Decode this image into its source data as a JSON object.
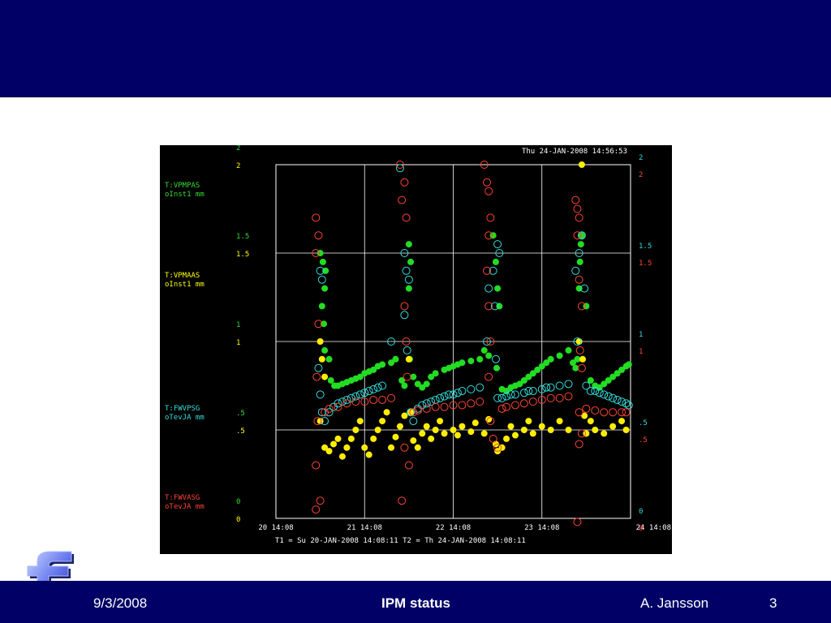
{
  "slide": {
    "footer_date": "9/3/2008",
    "footer_title": "IPM status",
    "footer_author": "A. Jansson",
    "footer_page": "3",
    "logo_letter": "f",
    "colors": {
      "bar": "#000066",
      "background": "#ffffff",
      "plot_bg": "#000000"
    }
  },
  "chart_data": {
    "type": "scatter",
    "title": "Thu 24-JAN-2008 14:56:53",
    "timespan": "T1 = Su 20-JAN-2008 14:08:11       T2 = Th 24-JAN-2008 14:08:11",
    "x_ticks": [
      "20 14:08",
      "21 14:08",
      "22 14:08",
      "23 14:08",
      "24 14:08"
    ],
    "xlim": [
      0,
      4
    ],
    "x_unit": "days after 20-JAN-2008 14:08",
    "ylim": [
      0,
      2
    ],
    "grid": true,
    "left_axes": [
      {
        "color": "#33dd33",
        "name": "T:VPMPAS",
        "desc": "oInst1  mm",
        "ticks": [
          "2",
          "1.5",
          "1",
          ".5",
          "0"
        ]
      },
      {
        "color": "#ffff00",
        "name": "T:VPMAAS",
        "desc": "oInst1  mm",
        "ticks": [
          "2",
          "1.5",
          "1",
          ".5",
          "0"
        ]
      }
    ],
    "right_axes": [
      {
        "color": "#33dddd",
        "name": "T:FWVPSG",
        "desc": "oTevJA  mm",
        "ticks": [
          "2",
          "1.5",
          "1",
          ".5",
          "0"
        ]
      },
      {
        "color": "#ff4433",
        "name": "T:FWVASG",
        "desc": "oTevJA  mm",
        "ticks": [
          "2",
          "1.5",
          "1",
          ".5",
          "0"
        ]
      }
    ],
    "series": [
      {
        "name": "T:VPMPAS",
        "color": "#22dd22",
        "marker": "filled",
        "points": [
          [
            0.55,
            1.3
          ],
          [
            0.5,
            1.5
          ],
          [
            0.53,
            1.45
          ],
          [
            0.56,
            1.4
          ],
          [
            0.52,
            1.2
          ],
          [
            0.54,
            1.1
          ],
          [
            0.55,
            0.95
          ],
          [
            0.6,
            0.9
          ],
          [
            0.62,
            0.78
          ],
          [
            0.66,
            0.75
          ],
          [
            0.7,
            0.75
          ],
          [
            0.75,
            0.76
          ],
          [
            0.8,
            0.77
          ],
          [
            0.85,
            0.78
          ],
          [
            0.9,
            0.79
          ],
          [
            0.95,
            0.8
          ],
          [
            1.0,
            0.82
          ],
          [
            1.05,
            0.83
          ],
          [
            1.1,
            0.84
          ],
          [
            1.15,
            0.86
          ],
          [
            1.2,
            0.87
          ],
          [
            1.3,
            0.88
          ],
          [
            1.35,
            0.9
          ],
          [
            1.42,
            0.78
          ],
          [
            1.45,
            0.75
          ],
          [
            1.5,
            1.55
          ],
          [
            1.52,
            1.45
          ],
          [
            1.5,
            1.3
          ],
          [
            1.51,
            0.9
          ],
          [
            1.55,
            0.8
          ],
          [
            1.6,
            0.76
          ],
          [
            1.65,
            0.74
          ],
          [
            1.7,
            0.76
          ],
          [
            1.75,
            0.8
          ],
          [
            1.8,
            0.82
          ],
          [
            1.9,
            0.84
          ],
          [
            1.95,
            0.85
          ],
          [
            2.0,
            0.86
          ],
          [
            2.05,
            0.87
          ],
          [
            2.1,
            0.88
          ],
          [
            2.2,
            0.89
          ],
          [
            2.3,
            0.9
          ],
          [
            2.35,
            0.95
          ],
          [
            2.4,
            0.92
          ],
          [
            2.45,
            1.6
          ],
          [
            2.48,
            1.45
          ],
          [
            2.5,
            1.3
          ],
          [
            2.52,
            1.2
          ],
          [
            2.49,
            0.85
          ],
          [
            2.55,
            0.73
          ],
          [
            2.6,
            0.72
          ],
          [
            2.65,
            0.74
          ],
          [
            2.7,
            0.75
          ],
          [
            2.75,
            0.76
          ],
          [
            2.8,
            0.78
          ],
          [
            2.85,
            0.8
          ],
          [
            2.9,
            0.82
          ],
          [
            2.95,
            0.84
          ],
          [
            3.0,
            0.86
          ],
          [
            3.05,
            0.88
          ],
          [
            3.1,
            0.9
          ],
          [
            3.2,
            0.92
          ],
          [
            3.3,
            0.95
          ],
          [
            3.35,
            0.88
          ],
          [
            3.38,
            0.85
          ],
          [
            3.4,
            0.9
          ],
          [
            3.42,
            1.3
          ],
          [
            3.43,
            1.45
          ],
          [
            3.44,
            1.55
          ],
          [
            3.45,
            1.6
          ],
          [
            3.5,
            1.2
          ],
          [
            3.55,
            0.78
          ],
          [
            3.6,
            0.75
          ],
          [
            3.65,
            0.74
          ],
          [
            3.7,
            0.76
          ],
          [
            3.75,
            0.78
          ],
          [
            3.8,
            0.8
          ],
          [
            3.85,
            0.82
          ],
          [
            3.9,
            0.84
          ],
          [
            3.95,
            0.86
          ],
          [
            3.98,
            0.87
          ]
        ]
      },
      {
        "name": "T:VPMAAS",
        "color": "#ffee00",
        "marker": "filled",
        "points": [
          [
            0.5,
            1.0
          ],
          [
            0.52,
            0.9
          ],
          [
            0.55,
            0.8
          ],
          [
            0.5,
            0.55
          ],
          [
            0.55,
            0.4
          ],
          [
            0.6,
            0.38
          ],
          [
            0.65,
            0.42
          ],
          [
            0.7,
            0.45
          ],
          [
            0.75,
            0.35
          ],
          [
            0.8,
            0.4
          ],
          [
            0.85,
            0.45
          ],
          [
            0.9,
            0.5
          ],
          [
            0.95,
            0.55
          ],
          [
            1.0,
            0.4
          ],
          [
            1.05,
            0.36
          ],
          [
            1.1,
            0.45
          ],
          [
            1.15,
            0.5
          ],
          [
            1.2,
            0.55
          ],
          [
            1.25,
            0.6
          ],
          [
            1.3,
            0.4
          ],
          [
            1.35,
            0.46
          ],
          [
            1.4,
            0.52
          ],
          [
            1.45,
            0.58
          ],
          [
            1.5,
            0.9
          ],
          [
            1.52,
            0.6
          ],
          [
            1.55,
            0.44
          ],
          [
            1.6,
            0.4
          ],
          [
            1.65,
            0.48
          ],
          [
            1.7,
            0.52
          ],
          [
            1.75,
            0.45
          ],
          [
            1.8,
            0.5
          ],
          [
            1.85,
            0.55
          ],
          [
            1.9,
            0.48
          ],
          [
            2.0,
            0.5
          ],
          [
            2.05,
            0.47
          ],
          [
            2.1,
            0.52
          ],
          [
            2.2,
            0.49
          ],
          [
            2.25,
            0.54
          ],
          [
            2.35,
            0.48
          ],
          [
            2.4,
            0.56
          ],
          [
            2.48,
            0.42
          ],
          [
            2.5,
            0.38
          ],
          [
            2.55,
            0.4
          ],
          [
            2.6,
            0.45
          ],
          [
            2.65,
            0.52
          ],
          [
            2.7,
            0.47
          ],
          [
            2.8,
            0.5
          ],
          [
            2.85,
            0.55
          ],
          [
            2.9,
            0.48
          ],
          [
            3.0,
            0.52
          ],
          [
            3.1,
            0.5
          ],
          [
            3.2,
            0.55
          ],
          [
            3.3,
            0.5
          ],
          [
            3.42,
            1.0
          ],
          [
            3.45,
            2.0
          ],
          [
            3.46,
            0.9
          ],
          [
            3.48,
            0.58
          ],
          [
            3.5,
            0.48
          ],
          [
            3.55,
            0.55
          ],
          [
            3.6,
            0.5
          ],
          [
            3.7,
            0.48
          ],
          [
            3.8,
            0.52
          ],
          [
            3.9,
            0.55
          ],
          [
            3.95,
            0.5
          ]
        ]
      },
      {
        "name": "T:FWVPSG",
        "color": "#33dddd",
        "marker": "hollow",
        "points": [
          [
            0.5,
            1.4
          ],
          [
            0.52,
            1.35
          ],
          [
            0.48,
            0.85
          ],
          [
            0.5,
            0.7
          ],
          [
            0.52,
            0.6
          ],
          [
            0.55,
            0.55
          ],
          [
            0.6,
            0.6
          ],
          [
            0.65,
            0.63
          ],
          [
            0.7,
            0.65
          ],
          [
            0.75,
            0.66
          ],
          [
            0.8,
            0.67
          ],
          [
            0.85,
            0.68
          ],
          [
            0.9,
            0.69
          ],
          [
            0.95,
            0.7
          ],
          [
            1.0,
            0.71
          ],
          [
            1.05,
            0.72
          ],
          [
            1.1,
            0.73
          ],
          [
            1.15,
            0.74
          ],
          [
            1.2,
            0.75
          ],
          [
            1.3,
            1.0
          ],
          [
            1.4,
            1.98
          ],
          [
            1.45,
            1.5
          ],
          [
            1.47,
            1.4
          ],
          [
            1.5,
            1.35
          ],
          [
            1.45,
            1.15
          ],
          [
            1.48,
            0.95
          ],
          [
            1.52,
            0.6
          ],
          [
            1.55,
            0.55
          ],
          [
            1.6,
            0.62
          ],
          [
            1.65,
            0.64
          ],
          [
            1.7,
            0.65
          ],
          [
            1.75,
            0.66
          ],
          [
            1.8,
            0.67
          ],
          [
            1.85,
            0.68
          ],
          [
            1.9,
            0.69
          ],
          [
            1.95,
            0.7
          ],
          [
            2.0,
            0.7
          ],
          [
            2.05,
            0.71
          ],
          [
            2.1,
            0.72
          ],
          [
            2.2,
            0.73
          ],
          [
            2.3,
            0.74
          ],
          [
            2.38,
            1.0
          ],
          [
            2.4,
            1.3
          ],
          [
            2.45,
            1.4
          ],
          [
            2.47,
            1.2
          ],
          [
            2.5,
            1.55
          ],
          [
            2.52,
            1.5
          ],
          [
            2.48,
            0.9
          ],
          [
            2.5,
            0.68
          ],
          [
            2.55,
            0.68
          ],
          [
            2.6,
            0.69
          ],
          [
            2.65,
            0.7
          ],
          [
            2.7,
            0.7
          ],
          [
            2.8,
            0.71
          ],
          [
            2.85,
            0.72
          ],
          [
            2.9,
            0.72
          ],
          [
            3.0,
            0.73
          ],
          [
            3.05,
            0.74
          ],
          [
            3.1,
            0.74
          ],
          [
            3.2,
            0.75
          ],
          [
            3.3,
            0.76
          ],
          [
            3.38,
            1.4
          ],
          [
            3.4,
            1.0
          ],
          [
            3.42,
            1.5
          ],
          [
            3.45,
            1.6
          ],
          [
            3.48,
            1.3
          ],
          [
            3.5,
            0.75
          ],
          [
            3.55,
            0.72
          ],
          [
            3.6,
            0.72
          ],
          [
            3.65,
            0.71
          ],
          [
            3.7,
            0.7
          ],
          [
            3.75,
            0.69
          ],
          [
            3.8,
            0.68
          ],
          [
            3.85,
            0.67
          ],
          [
            3.9,
            0.66
          ],
          [
            3.95,
            0.65
          ],
          [
            3.98,
            0.64
          ]
        ]
      },
      {
        "name": "T:FWVASG",
        "color": "#ff4433",
        "marker": "hollow",
        "points": [
          [
            0.45,
            1.7
          ],
          [
            0.48,
            1.6
          ],
          [
            0.45,
            1.5
          ],
          [
            0.48,
            1.1
          ],
          [
            0.46,
            0.8
          ],
          [
            0.47,
            0.55
          ],
          [
            0.45,
            0.3
          ],
          [
            0.5,
            0.1
          ],
          [
            0.45,
            0.05
          ],
          [
            0.55,
            0.6
          ],
          [
            0.6,
            0.62
          ],
          [
            0.7,
            0.63
          ],
          [
            0.8,
            0.65
          ],
          [
            0.9,
            0.66
          ],
          [
            1.0,
            0.66
          ],
          [
            1.1,
            0.67
          ],
          [
            1.2,
            0.67
          ],
          [
            1.3,
            0.68
          ],
          [
            1.4,
            2.0
          ],
          [
            1.42,
            1.8
          ],
          [
            1.45,
            1.9
          ],
          [
            1.47,
            1.7
          ],
          [
            1.45,
            1.2
          ],
          [
            1.47,
            1.0
          ],
          [
            1.48,
            0.8
          ],
          [
            1.45,
            0.4
          ],
          [
            1.42,
            0.1
          ],
          [
            1.5,
            0.3
          ],
          [
            1.55,
            0.6
          ],
          [
            1.6,
            0.61
          ],
          [
            1.7,
            0.62
          ],
          [
            1.8,
            0.63
          ],
          [
            1.9,
            0.63
          ],
          [
            2.0,
            0.64
          ],
          [
            2.1,
            0.64
          ],
          [
            2.2,
            0.65
          ],
          [
            2.3,
            0.66
          ],
          [
            2.35,
            2.0
          ],
          [
            2.38,
            1.9
          ],
          [
            2.4,
            1.85
          ],
          [
            2.42,
            1.7
          ],
          [
            2.4,
            1.6
          ],
          [
            2.38,
            1.4
          ],
          [
            2.4,
            1.2
          ],
          [
            2.42,
            1.0
          ],
          [
            2.4,
            0.8
          ],
          [
            2.42,
            0.55
          ],
          [
            2.45,
            0.45
          ],
          [
            2.5,
            0.4
          ],
          [
            2.55,
            0.62
          ],
          [
            2.6,
            0.63
          ],
          [
            2.7,
            0.64
          ],
          [
            2.8,
            0.65
          ],
          [
            2.9,
            0.66
          ],
          [
            3.0,
            0.67
          ],
          [
            3.1,
            0.68
          ],
          [
            3.2,
            0.68
          ],
          [
            3.3,
            0.69
          ],
          [
            3.38,
            1.8
          ],
          [
            3.4,
            1.75
          ],
          [
            3.42,
            1.7
          ],
          [
            3.4,
            1.6
          ],
          [
            3.42,
            1.35
          ],
          [
            3.45,
            1.2
          ],
          [
            3.43,
            0.95
          ],
          [
            3.45,
            0.85
          ],
          [
            3.42,
            0.6
          ],
          [
            3.45,
            0.48
          ],
          [
            3.42,
            0.42
          ],
          [
            3.4,
            -0.02
          ],
          [
            3.5,
            0.62
          ],
          [
            3.6,
            0.61
          ],
          [
            3.7,
            0.6
          ],
          [
            3.8,
            0.6
          ],
          [
            3.9,
            0.6
          ],
          [
            3.95,
            0.6
          ]
        ]
      }
    ]
  }
}
